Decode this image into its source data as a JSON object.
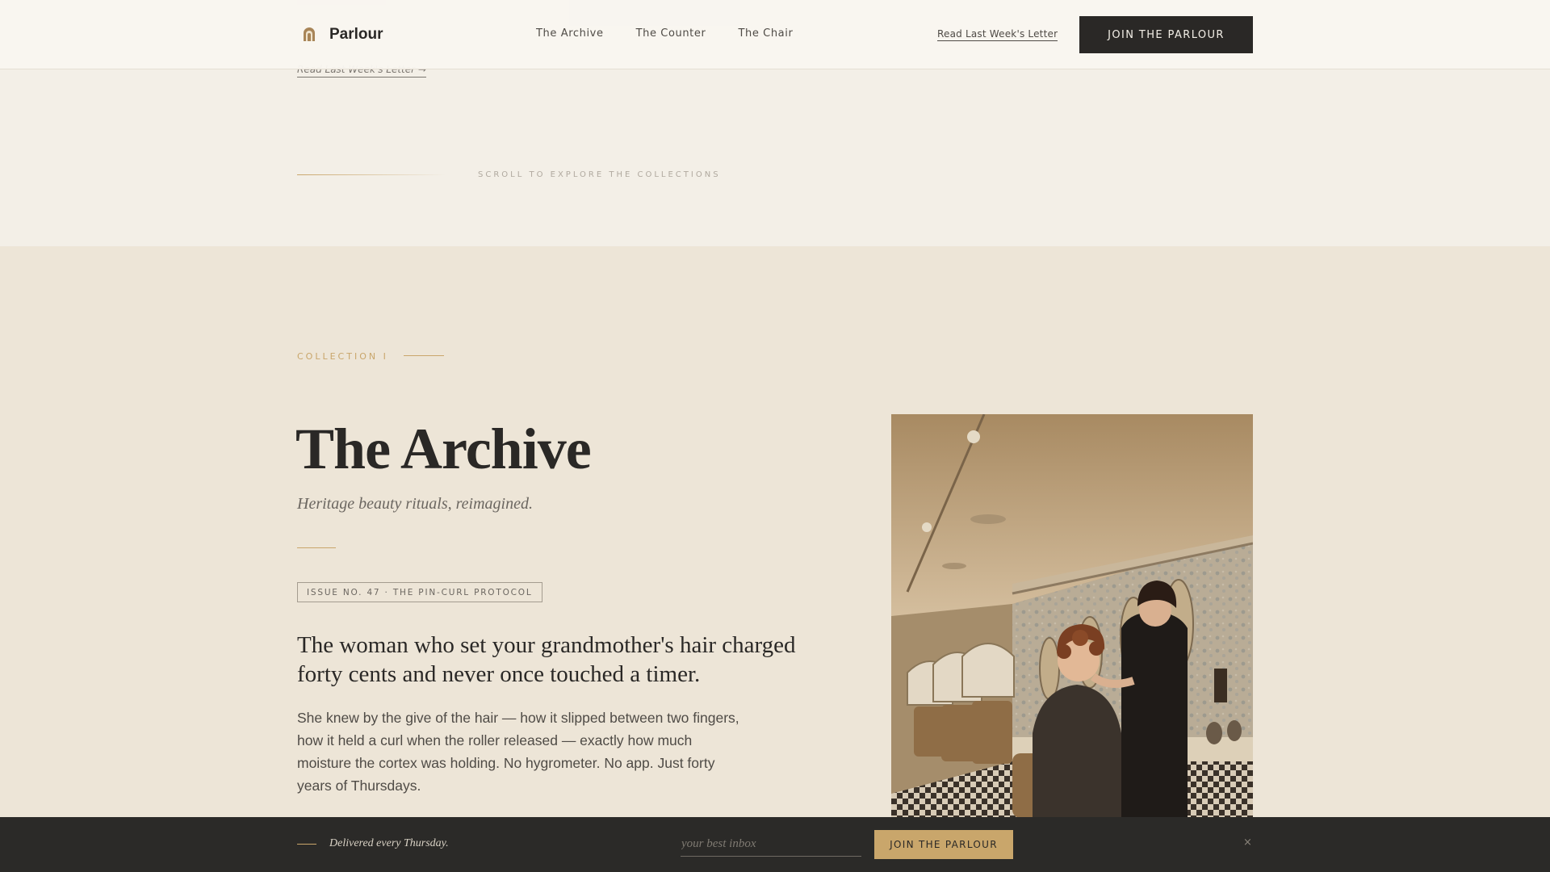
{
  "header": {
    "logo_text": "Parlour",
    "nav": [
      "The Archive",
      "The Counter",
      "The Chair"
    ],
    "letter_link": "Read Last Week's Letter",
    "join_button": "JOIN THE PARLOUR"
  },
  "hero_tail": {
    "letter_link": "Read Last Week's Letter →",
    "scroll_text": "SCROLL TO EXPLORE THE COLLECTIONS"
  },
  "collection": {
    "eyebrow": "COLLECTION I",
    "title": "The Archive",
    "subtitle": "Heritage beauty rituals, reimagined.",
    "issue_tag": "ISSUE NO. 47 · THE PIN-CURL PROTOCOL",
    "lede": "The woman who set your grandmother's hair charged forty cents and never once touched a timer.",
    "body": "She knew by the give of the hair — how it slipped between two fingers, how it held a curl when the roller released — exactly how much moisture the cortex was holding. No hygrometer. No app. Just forty years of Thursdays."
  },
  "bottom_bar": {
    "tagline": "Delivered every Thursday.",
    "input_placeholder": "your best inbox",
    "join_button": "JOIN THE PARLOUR",
    "close_glyph": "×"
  },
  "colors": {
    "accent_gold": "#c9a66b",
    "ink": "#2a2826",
    "cream": "#f3efe7",
    "section_bg": "#ede5d7"
  }
}
